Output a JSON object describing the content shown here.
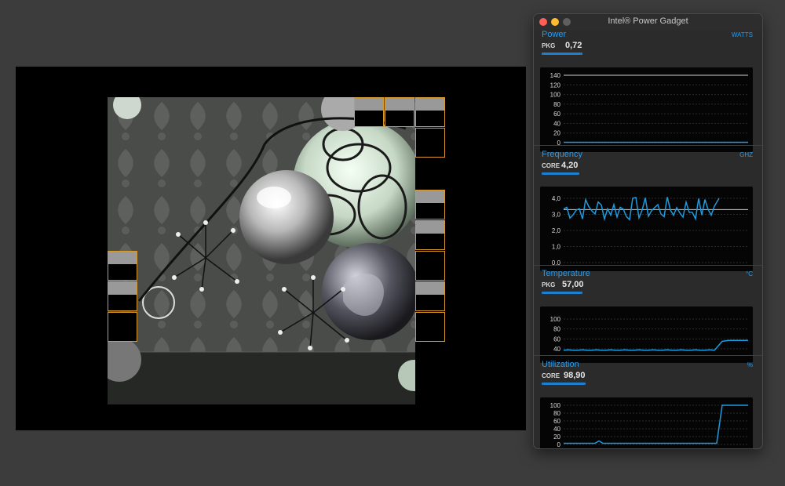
{
  "window_title": "Intel® Power Gadget",
  "sections": {
    "power": {
      "title": "Power",
      "unit": "WATTS",
      "label": "PKG",
      "value": "0,72",
      "ticks": [
        "140",
        "120",
        "100",
        "80",
        "60",
        "40",
        "20",
        "0"
      ],
      "ref_value": 140,
      "series_hint": "flat near 0"
    },
    "frequency": {
      "title": "Frequency",
      "unit": "GHZ",
      "label": "CORE",
      "value": "4,20",
      "ticks": [
        "4,0",
        "3,0",
        "2,0",
        "1,0",
        "0,0"
      ],
      "ref_value": 3.3
    },
    "temperature": {
      "title": "Temperature",
      "unit": "°C",
      "label": "PKG",
      "value": "57,00",
      "ticks": [
        "100",
        "80",
        "60",
        "40"
      ]
    },
    "utilization": {
      "title": "Utilization",
      "unit": "%",
      "label": "CORE",
      "value": "98,90",
      "ticks": [
        "100",
        "80",
        "60",
        "40",
        "20",
        "0"
      ]
    }
  },
  "colors": {
    "accent": "#2b9bea",
    "tile_border": "#d89a2a",
    "series": "#1d9be0"
  }
}
